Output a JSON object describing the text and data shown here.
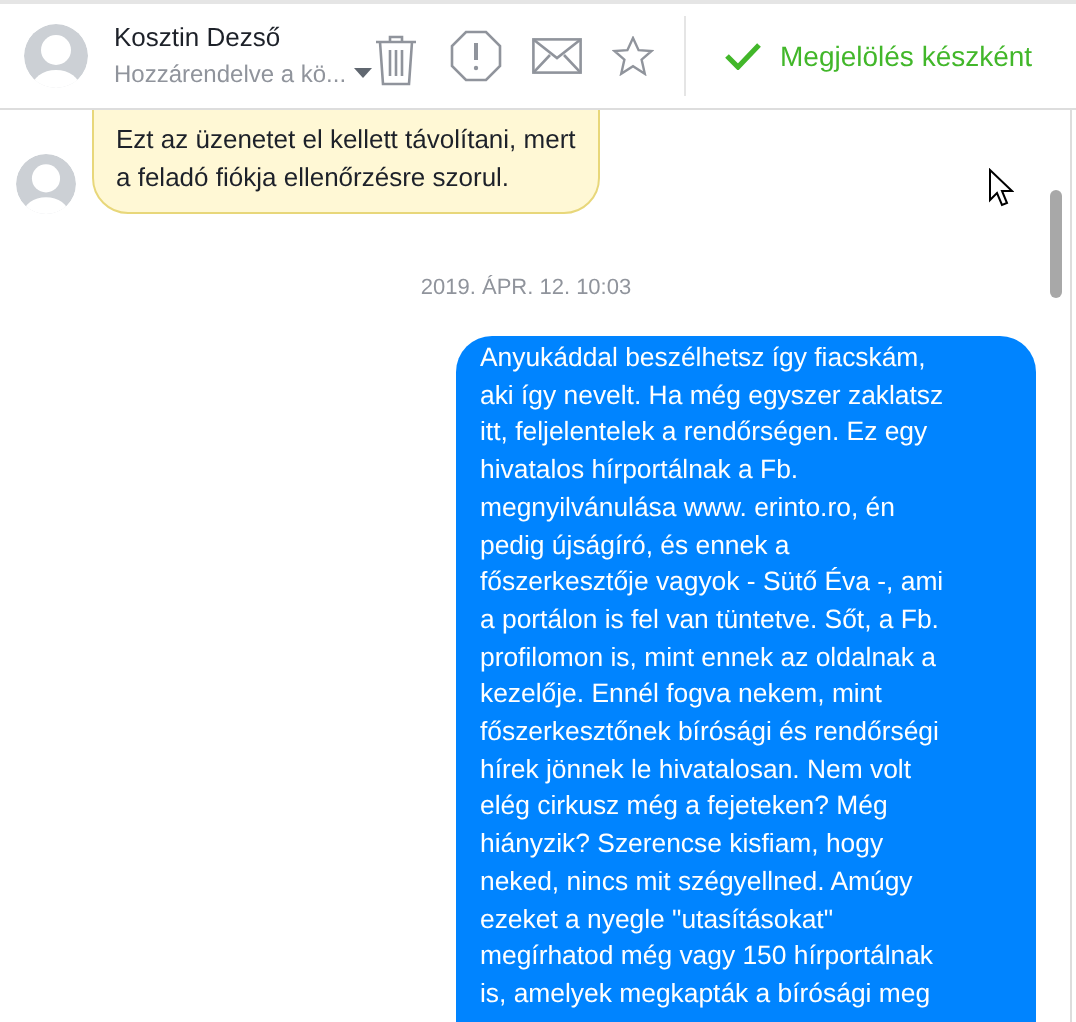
{
  "header": {
    "contact_name": "Kosztin Dezső",
    "assignment": "Hozzárendelve a kö...",
    "mark_done_button": "Megjelölés készként"
  },
  "messages": [
    {
      "kind": "notice",
      "lines": [
        "Ezt az üzenetet el kellett távolítani, mert",
        "a feladó fiókja ellenőrzésre szorul."
      ]
    },
    {
      "kind": "timestamp",
      "text": "2019. ÁPR. 12. 10:03"
    },
    {
      "kind": "outgoing",
      "lines": [
        "Anyukáddal beszélhetsz így fiacskám,",
        "aki így nevelt. Ha még egyszer zaklatsz",
        "itt, feljelentelek a rendőrségen. Ez egy",
        "hivatalos hírportálnak a Fb.",
        "megnyilvánulása www. erinto.ro, én",
        "pedig újságíró, és ennek a",
        "főszerkesztője vagyok - Sütő Éva -, ami",
        "a portálon is fel van tüntetve. Sőt, a Fb.",
        "profilomon is, mint ennek az oldalnak a",
        "kezelője. Ennél fogva nekem, mint",
        "főszerkesztőnek bírósági és rendőrségi",
        "hírek jönnek le hivatalosan. Nem volt",
        "elég cirkusz még a fejeteken? Még",
        "hiányzik? Szerencse kisfiam, hogy",
        "neked, nincs mit szégyellned. Amúgy",
        "ezeket a nyegle \"utasításokat\"",
        "megírhatod még vagy 150 hírportálnak",
        "is, amelyek megkapták a bírósági meg"
      ]
    }
  ]
}
